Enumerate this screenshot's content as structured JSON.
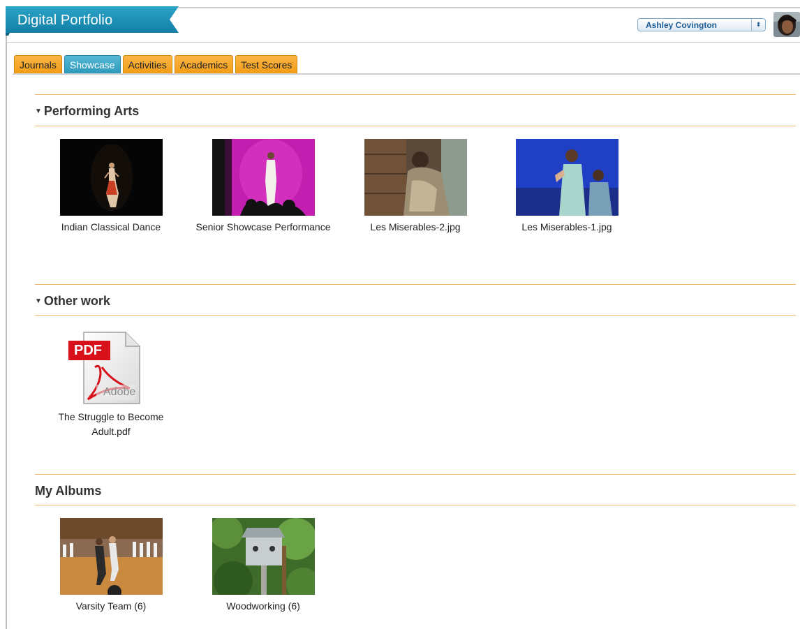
{
  "app": {
    "title": "Digital Portfolio"
  },
  "user": {
    "name": "Ashley Covington",
    "select_arrows": "⬍"
  },
  "tabs": [
    {
      "label": "Journals",
      "active": false
    },
    {
      "label": "Showcase",
      "active": true
    },
    {
      "label": "Activities",
      "active": false
    },
    {
      "label": "Academics",
      "active": false
    },
    {
      "label": "Test Scores",
      "active": false
    }
  ],
  "sections": {
    "performing_arts": {
      "title": "Performing Arts",
      "items": [
        {
          "caption": "Indian Classical Dance"
        },
        {
          "caption": "Senior Showcase Performance"
        },
        {
          "caption": "Les Miserables-2.jpg"
        },
        {
          "caption": "Les Miserables-1.jpg"
        }
      ]
    },
    "other_work": {
      "title": "Other work",
      "items": [
        {
          "caption_line1": "The Struggle to Become",
          "caption_line2": "Adult.pdf",
          "icon": "pdf-icon",
          "icon_label": "PDF",
          "icon_brand": "Adobe"
        }
      ]
    },
    "my_albums": {
      "title": "My Albums",
      "items": [
        {
          "caption": "Varsity Team (6)"
        },
        {
          "caption": "Woodworking (6)"
        }
      ]
    }
  },
  "colors": {
    "tab_orange": "#f29c14",
    "tab_active_blue": "#2c98bb",
    "ribbon_blue": "#1e8fb3",
    "section_rule": "#f4b46a",
    "user_text": "#1f5d96",
    "pdf_red": "#d8101a"
  }
}
